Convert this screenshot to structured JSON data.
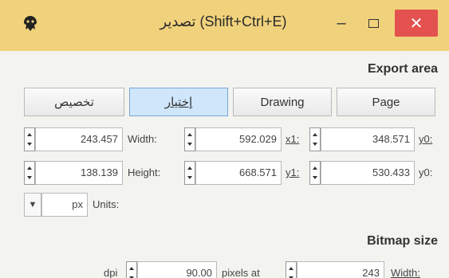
{
  "window": {
    "title": "تصدير (Shift+Ctrl+E)",
    "minimize_glyph": "–",
    "close_glyph": "✕",
    "close_color": "#e3524f",
    "titlebar_color": "#f1d27c"
  },
  "export_area": {
    "heading": "Export area",
    "buttons": {
      "custom": "تخصيص",
      "selection": "إختيار",
      "drawing": "Drawing",
      "page": "Page"
    },
    "active_button": "selection",
    "row1": {
      "x0_value": "243.457",
      "width_label": "Width:",
      "width_value": "592.029",
      "x1_label": "x1:",
      "x1_value": "348.571",
      "y0_label": "y0:"
    },
    "row2": {
      "y0_value": "138.139",
      "height_label": "Height:",
      "height_value": "668.571",
      "y1_label": "y1:",
      "y1_value": "530.433",
      "y0_label": "y0:"
    },
    "units": {
      "value": "px",
      "label": "Units:"
    }
  },
  "bitmap_size": {
    "heading": "Bitmap size",
    "dpi_label": "dpi",
    "dpi_value": "90.00",
    "pixels_at_label": "pixels at",
    "width_value": "243",
    "width_label": "Width:"
  }
}
